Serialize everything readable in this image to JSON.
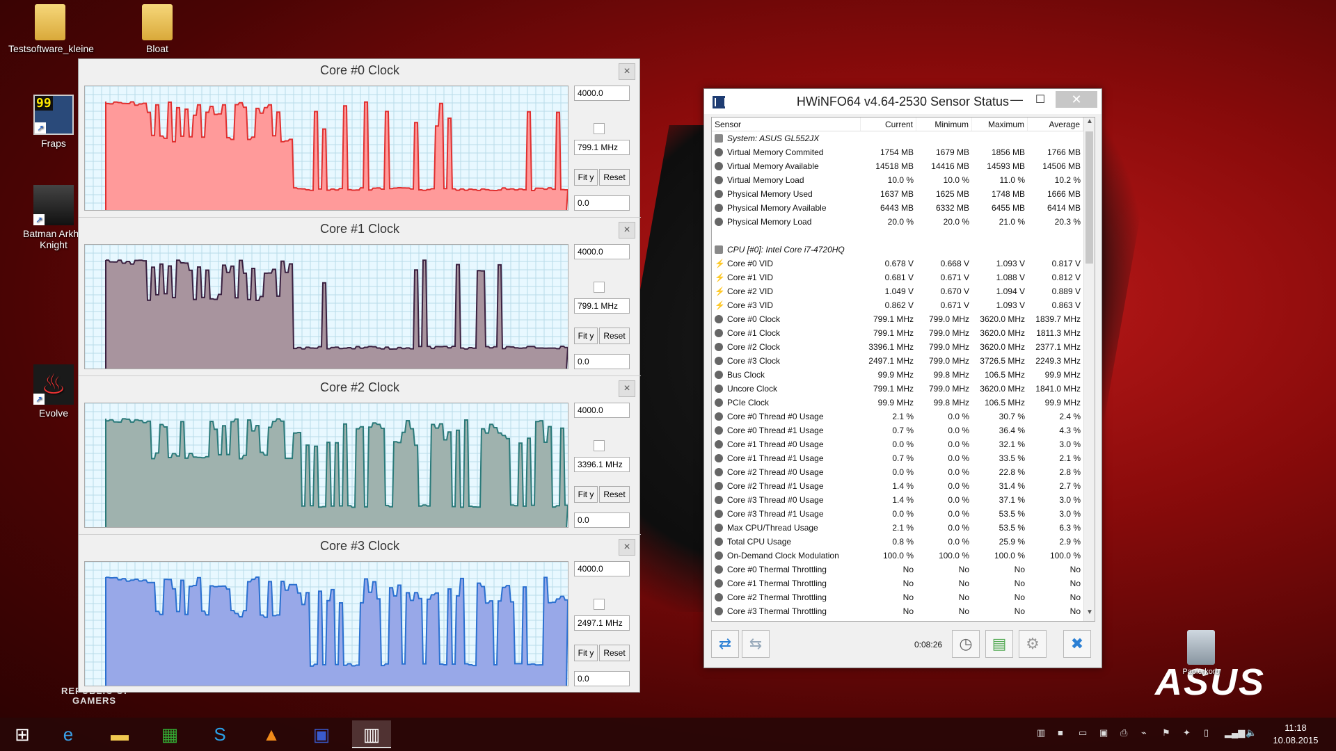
{
  "desktop": {
    "icons": [
      {
        "label": "Testsoftware_kleine",
        "icon": "folder-icon"
      },
      {
        "label": "Bloat",
        "icon": "folder-icon"
      },
      {
        "label": "Fraps",
        "icon": "fraps-icon",
        "badge": "99"
      },
      {
        "label": "Batman Arkha Knight",
        "icon": "batman-icon"
      },
      {
        "label": "Evolve",
        "icon": "evolve-icon"
      }
    ],
    "rog_line1": "REPUBLIC OF",
    "rog_line2": "GAMERS",
    "asus_logo": "ASUS",
    "recycle_label": "Papierkorb"
  },
  "graphs": [
    {
      "title": "Core #0 Clock",
      "ymax": "4000.0",
      "current": "799.1 MHz",
      "ymin": "0.0",
      "fit": "Fit y",
      "reset": "Reset",
      "fill": "#ff9a9a",
      "stroke": "#e03030"
    },
    {
      "title": "Core #1 Clock",
      "ymax": "4000.0",
      "current": "799.1 MHz",
      "ymin": "0.0",
      "fit": "Fit y",
      "reset": "Reset",
      "fill": "#a8949e",
      "stroke": "#3a2040"
    },
    {
      "title": "Core #2 Clock",
      "ymax": "4000.0",
      "current": "3396.1 MHz",
      "ymin": "0.0",
      "fit": "Fit y",
      "reset": "Reset",
      "fill": "#9fb2ae",
      "stroke": "#2a7a7a"
    },
    {
      "title": "Core #3 Clock",
      "ymax": "4000.0",
      "current": "2497.1 MHz",
      "ymin": "0.0",
      "fit": "Fit y",
      "reset": "Reset",
      "fill": "#98a8e8",
      "stroke": "#2a70d0"
    }
  ],
  "hwinfo": {
    "title": "HWiNFO64 v4.64-2530 Sensor Status",
    "columns": [
      "Sensor",
      "Current",
      "Minimum",
      "Maximum",
      "Average"
    ],
    "rows": [
      {
        "type": "group",
        "name": "System: ASUS GL552JX",
        "cur": "",
        "min": "",
        "max": "",
        "avg": ""
      },
      {
        "type": "sensor",
        "name": "Virtual Memory Commited",
        "cur": "1754 MB",
        "min": "1679 MB",
        "max": "1856 MB",
        "avg": "1766 MB"
      },
      {
        "type": "sensor",
        "name": "Virtual Memory Available",
        "cur": "14518 MB",
        "min": "14416 MB",
        "max": "14593 MB",
        "avg": "14506 MB"
      },
      {
        "type": "sensor",
        "name": "Virtual Memory Load",
        "cur": "10.0 %",
        "min": "10.0 %",
        "max": "11.0 %",
        "avg": "10.2 %"
      },
      {
        "type": "sensor",
        "name": "Physical Memory Used",
        "cur": "1637 MB",
        "min": "1625 MB",
        "max": "1748 MB",
        "avg": "1666 MB"
      },
      {
        "type": "sensor",
        "name": "Physical Memory Available",
        "cur": "6443 MB",
        "min": "6332 MB",
        "max": "6455 MB",
        "avg": "6414 MB"
      },
      {
        "type": "sensor",
        "name": "Physical Memory Load",
        "cur": "20.0 %",
        "min": "20.0 %",
        "max": "21.0 %",
        "avg": "20.3 %"
      },
      {
        "type": "blank",
        "name": "",
        "cur": "",
        "min": "",
        "max": "",
        "avg": ""
      },
      {
        "type": "group",
        "name": "CPU [#0]: Intel Core i7-4720HQ",
        "cur": "",
        "min": "",
        "max": "",
        "avg": ""
      },
      {
        "type": "volt",
        "name": "Core #0 VID",
        "cur": "0.678 V",
        "min": "0.668 V",
        "max": "1.093 V",
        "avg": "0.817 V"
      },
      {
        "type": "volt",
        "name": "Core #1 VID",
        "cur": "0.681 V",
        "min": "0.671 V",
        "max": "1.088 V",
        "avg": "0.812 V"
      },
      {
        "type": "volt",
        "name": "Core #2 VID",
        "cur": "1.049 V",
        "min": "0.670 V",
        "max": "1.094 V",
        "avg": "0.889 V"
      },
      {
        "type": "volt",
        "name": "Core #3 VID",
        "cur": "0.862 V",
        "min": "0.671 V",
        "max": "1.093 V",
        "avg": "0.863 V"
      },
      {
        "type": "sensor",
        "name": "Core #0 Clock",
        "cur": "799.1 MHz",
        "min": "799.0 MHz",
        "max": "3620.0 MHz",
        "avg": "1839.7 MHz"
      },
      {
        "type": "sensor",
        "name": "Core #1 Clock",
        "cur": "799.1 MHz",
        "min": "799.0 MHz",
        "max": "3620.0 MHz",
        "avg": "1811.3 MHz"
      },
      {
        "type": "sensor",
        "name": "Core #2 Clock",
        "cur": "3396.1 MHz",
        "min": "799.0 MHz",
        "max": "3620.0 MHz",
        "avg": "2377.1 MHz"
      },
      {
        "type": "sensor",
        "name": "Core #3 Clock",
        "cur": "2497.1 MHz",
        "min": "799.0 MHz",
        "max": "3726.5 MHz",
        "avg": "2249.3 MHz"
      },
      {
        "type": "sensor",
        "name": "Bus Clock",
        "cur": "99.9 MHz",
        "min": "99.8 MHz",
        "max": "106.5 MHz",
        "avg": "99.9 MHz"
      },
      {
        "type": "sensor",
        "name": "Uncore Clock",
        "cur": "799.1 MHz",
        "min": "799.0 MHz",
        "max": "3620.0 MHz",
        "avg": "1841.0 MHz"
      },
      {
        "type": "sensor",
        "name": "PCIe Clock",
        "cur": "99.9 MHz",
        "min": "99.8 MHz",
        "max": "106.5 MHz",
        "avg": "99.9 MHz"
      },
      {
        "type": "sensor",
        "name": "Core #0 Thread #0 Usage",
        "cur": "2.1 %",
        "min": "0.0 %",
        "max": "30.7 %",
        "avg": "2.4 %"
      },
      {
        "type": "sensor",
        "name": "Core #0 Thread #1 Usage",
        "cur": "0.7 %",
        "min": "0.0 %",
        "max": "36.4 %",
        "avg": "4.3 %"
      },
      {
        "type": "sensor",
        "name": "Core #1 Thread #0 Usage",
        "cur": "0.0 %",
        "min": "0.0 %",
        "max": "32.1 %",
        "avg": "3.0 %"
      },
      {
        "type": "sensor",
        "name": "Core #1 Thread #1 Usage",
        "cur": "0.7 %",
        "min": "0.0 %",
        "max": "33.5 %",
        "avg": "2.1 %"
      },
      {
        "type": "sensor",
        "name": "Core #2 Thread #0 Usage",
        "cur": "0.0 %",
        "min": "0.0 %",
        "max": "22.8 %",
        "avg": "2.8 %"
      },
      {
        "type": "sensor",
        "name": "Core #2 Thread #1 Usage",
        "cur": "1.4 %",
        "min": "0.0 %",
        "max": "31.4 %",
        "avg": "2.7 %"
      },
      {
        "type": "sensor",
        "name": "Core #3 Thread #0 Usage",
        "cur": "1.4 %",
        "min": "0.0 %",
        "max": "37.1 %",
        "avg": "3.0 %"
      },
      {
        "type": "sensor",
        "name": "Core #3 Thread #1 Usage",
        "cur": "0.0 %",
        "min": "0.0 %",
        "max": "53.5 %",
        "avg": "3.0 %"
      },
      {
        "type": "sensor",
        "name": "Max CPU/Thread Usage",
        "cur": "2.1 %",
        "min": "0.0 %",
        "max": "53.5 %",
        "avg": "6.3 %"
      },
      {
        "type": "sensor",
        "name": "Total CPU Usage",
        "cur": "0.8 %",
        "min": "0.0 %",
        "max": "25.9 %",
        "avg": "2.9 %"
      },
      {
        "type": "sensor",
        "name": "On-Demand Clock Modulation",
        "cur": "100.0 %",
        "min": "100.0 %",
        "max": "100.0 %",
        "avg": "100.0 %"
      },
      {
        "type": "sensor",
        "name": "Core #0 Thermal Throttling",
        "cur": "No",
        "min": "No",
        "max": "No",
        "avg": "No"
      },
      {
        "type": "sensor",
        "name": "Core #1 Thermal Throttling",
        "cur": "No",
        "min": "No",
        "max": "No",
        "avg": "No"
      },
      {
        "type": "sensor",
        "name": "Core #2 Thermal Throttling",
        "cur": "No",
        "min": "No",
        "max": "No",
        "avg": "No"
      },
      {
        "type": "sensor",
        "name": "Core #3 Thermal Throttling",
        "cur": "No",
        "min": "No",
        "max": "No",
        "avg": "No"
      }
    ],
    "timer": "0:08:26"
  },
  "taskbar": {
    "apps": [
      "start-icon",
      "internet-explorer-icon",
      "file-explorer-icon",
      "store-icon",
      "skype-icon",
      "vlc-icon",
      "save-icon",
      "hwinfo-icon"
    ],
    "time": "11:18",
    "date": "10.08.2015"
  }
}
